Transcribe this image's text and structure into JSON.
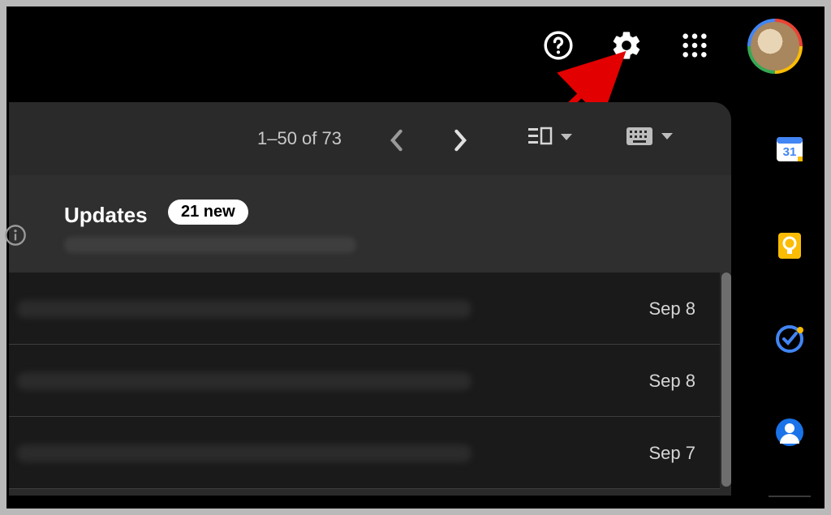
{
  "toolbar": {
    "pagination": "1–50 of 73"
  },
  "tabs": {
    "updates": {
      "label": "Updates",
      "badge": "21 new"
    }
  },
  "rows": [
    {
      "date": "Sep 8"
    },
    {
      "date": "Sep 8"
    },
    {
      "date": "Sep 7"
    }
  ],
  "side": {
    "calendar_day": "31"
  }
}
